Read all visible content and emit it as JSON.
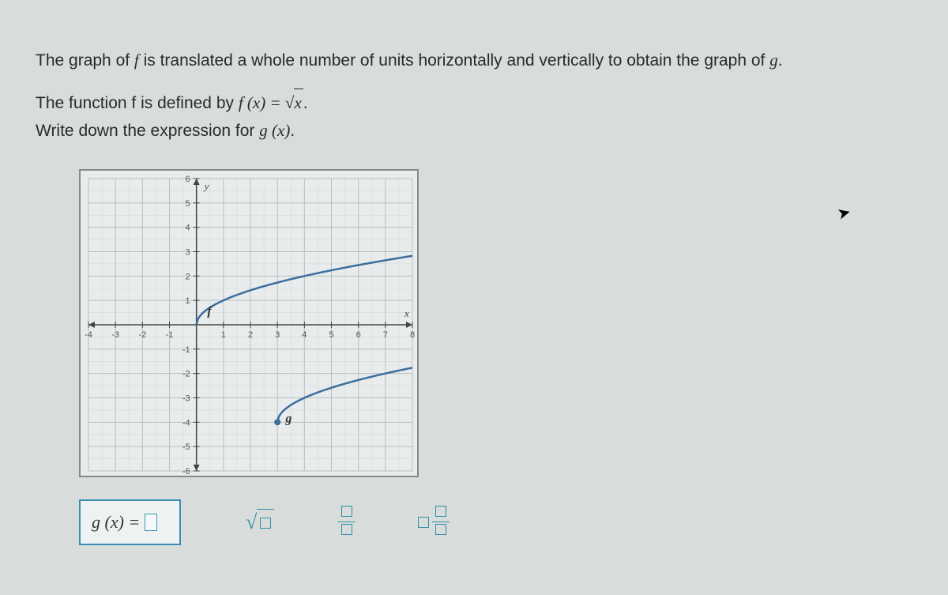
{
  "problem": {
    "line1_prefix": "The graph of ",
    "line1_f": "f",
    "line1_mid": " is translated a whole number of units horizontally and vertically to obtain the graph of ",
    "line1_g": "g",
    "line1_end": ".",
    "line2_prefix": "The function ",
    "line2_f": "f",
    "line2_mid": " is defined by ",
    "line2_fn": "f (x) = ",
    "line2_sqrt_arg": "x",
    "line2_end": ".",
    "line3_prefix": "Write down the expression for ",
    "line3_g": "g",
    "line3_paren": " (x)",
    "line3_end": "."
  },
  "chart_data": {
    "type": "line",
    "title": "",
    "xlabel": "x",
    "ylabel": "y",
    "xlim": [
      -4,
      8
    ],
    "ylim": [
      -6,
      6
    ],
    "xticks": [
      -4,
      -3,
      -2,
      -1,
      1,
      2,
      3,
      4,
      5,
      6,
      7,
      8
    ],
    "yticks": [
      -6,
      -5,
      -4,
      -3,
      -2,
      -1,
      1,
      2,
      3,
      4,
      5,
      6
    ],
    "series": [
      {
        "name": "f",
        "label_pos": {
          "x": 0.4,
          "y": 0.4
        },
        "points": [
          {
            "x": 0,
            "y": 0
          },
          {
            "x": 1,
            "y": 1
          },
          {
            "x": 4,
            "y": 2
          },
          {
            "x": 8,
            "y": 2.83
          }
        ]
      },
      {
        "name": "g",
        "label_pos": {
          "x": 3.3,
          "y": -4.0
        },
        "start_point": {
          "x": 3,
          "y": -4
        },
        "points": [
          {
            "x": 3,
            "y": -4
          },
          {
            "x": 4,
            "y": -3
          },
          {
            "x": 7,
            "y": -2
          },
          {
            "x": 8,
            "y": -1.76
          }
        ]
      }
    ]
  },
  "answer": {
    "lhs": "g (x) = "
  },
  "palette": {
    "sqrt": "√",
    "frac": "frac",
    "mixed": "mixed"
  }
}
